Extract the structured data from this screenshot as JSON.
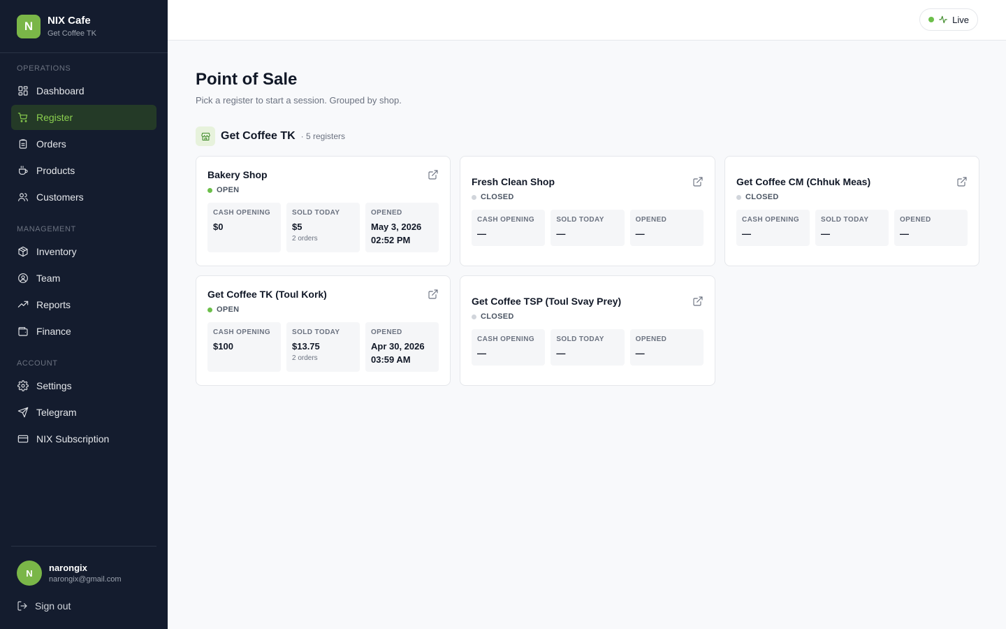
{
  "brand": {
    "logo_letter": "N",
    "name": "NIX Cafe",
    "subtitle": "Get Coffee TK"
  },
  "sidebar": {
    "sections": [
      {
        "label": "OPERATIONS",
        "items": [
          {
            "label": "Dashboard",
            "icon": "dashboard-icon"
          },
          {
            "label": "Register",
            "icon": "cart-icon",
            "active": true
          },
          {
            "label": "Orders",
            "icon": "clipboard-icon"
          },
          {
            "label": "Products",
            "icon": "coffee-cup-icon"
          },
          {
            "label": "Customers",
            "icon": "users-icon"
          }
        ]
      },
      {
        "label": "MANAGEMENT",
        "items": [
          {
            "label": "Inventory",
            "icon": "box-icon"
          },
          {
            "label": "Team",
            "icon": "user-circle-icon"
          },
          {
            "label": "Reports",
            "icon": "trend-up-icon"
          },
          {
            "label": "Finance",
            "icon": "wallet-icon"
          }
        ]
      },
      {
        "label": "ACCOUNT",
        "items": [
          {
            "label": "Settings",
            "icon": "gear-icon"
          },
          {
            "label": "Telegram",
            "icon": "send-icon"
          },
          {
            "label": "NIX Subscription",
            "icon": "credit-card-icon"
          }
        ]
      }
    ]
  },
  "user": {
    "initial": "N",
    "name": "narongix",
    "email": "narongix@gmail.com",
    "signout_label": "Sign out"
  },
  "topbar": {
    "live_label": "Live"
  },
  "page": {
    "title": "Point of Sale",
    "subtitle": "Pick a register to start a session. Grouped by shop."
  },
  "group": {
    "name": "Get Coffee TK",
    "count_label": "· 5 registers"
  },
  "labels": {
    "cash_opening": "CASH OPENING",
    "sold_today": "SOLD TODAY",
    "opened": "OPENED"
  },
  "registers": [
    {
      "name": "Bakery Shop",
      "status": "OPEN",
      "cash_opening": "$0",
      "sold_today": "$5",
      "orders": "2 orders",
      "opened_date": "May 3, 2026",
      "opened_time": "02:52 PM"
    },
    {
      "name": "Fresh Clean Shop",
      "status": "CLOSED",
      "cash_opening": "—",
      "sold_today": "—",
      "orders": "",
      "opened_date": "—",
      "opened_time": ""
    },
    {
      "name": "Get Coffee CM (Chhuk Meas)",
      "status": "CLOSED",
      "cash_opening": "—",
      "sold_today": "—",
      "orders": "",
      "opened_date": "—",
      "opened_time": ""
    },
    {
      "name": "Get Coffee TK (Toul Kork)",
      "status": "OPEN",
      "cash_opening": "$100",
      "sold_today": "$13.75",
      "orders": "2 orders",
      "opened_date": "Apr 30, 2026",
      "opened_time": "03:59 AM"
    },
    {
      "name": "Get Coffee TSP (Toul Svay Prey)",
      "status": "CLOSED",
      "cash_opening": "—",
      "sold_today": "—",
      "orders": "",
      "opened_date": "—",
      "opened_time": ""
    }
  ],
  "colors": {
    "sidebar_bg": "#141c2e",
    "accent": "#7ab648",
    "active_text": "#8bd04f",
    "open_dot": "#6cbf4a",
    "closed_dot": "#d1d5db"
  }
}
